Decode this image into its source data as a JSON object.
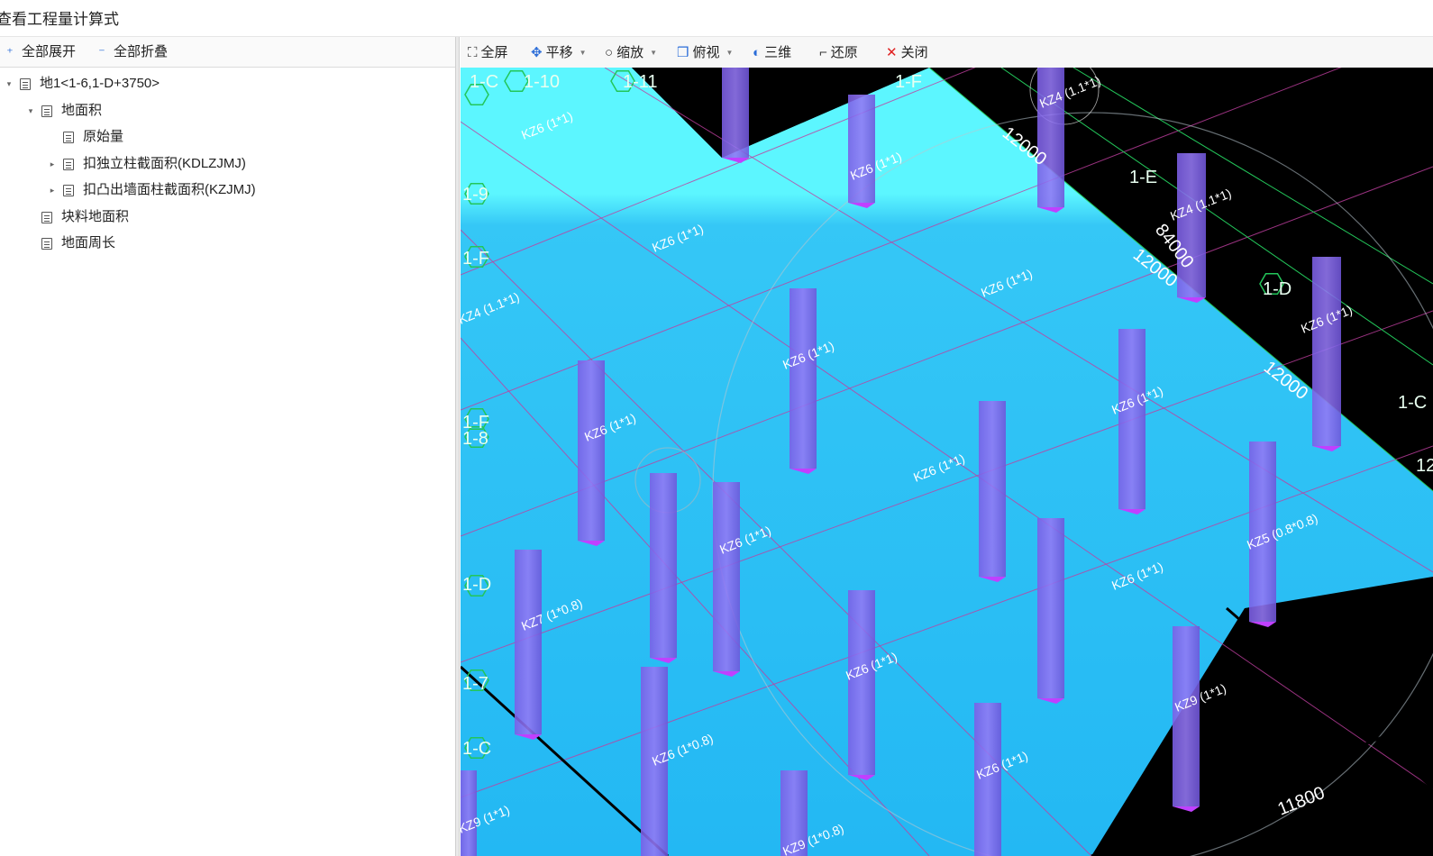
{
  "window": {
    "title": "查看工程量计算式"
  },
  "left_toolbar": {
    "expand_all": "全部展开",
    "collapse_all": "全部折叠"
  },
  "tree": [
    {
      "label": "地1<1-6,1-D+3750>",
      "arrow": "▾"
    },
    {
      "label": "地面积",
      "arrow": "▾"
    },
    {
      "label": "原始量",
      "arrow": ""
    },
    {
      "label": "扣独立柱截面积(KDLZJMJ)",
      "arrow": "▸"
    },
    {
      "label": "扣凸出墙面柱截面积(KZJMJ)",
      "arrow": "▸"
    },
    {
      "label": "块料地面积",
      "arrow": ""
    },
    {
      "label": "地面周长",
      "arrow": ""
    }
  ],
  "view_toolbar": {
    "fullscreen": "全屏",
    "pan": "平移",
    "zoom": "缩放",
    "topview": "俯视",
    "threed": "三维",
    "restore": "还原",
    "close": "关闭"
  },
  "view_icons": {
    "fullscreen": "fullscreen-icon",
    "pan": "pan-icon",
    "zoom": "zoom-icon",
    "topview": "cube-icon",
    "threed": "sphere-icon",
    "restore": "restore-icon",
    "close": "close-icon"
  },
  "colors": {
    "floor_light": "#5cf6ff",
    "floor_main": "#23b8f3",
    "column": "#8a6cf0",
    "grid_line": "#c03fa0",
    "axis_green": "#23c65a",
    "close_red": "#e02020",
    "background": "#000000"
  },
  "scene": {
    "axis_labels": [
      "1-C",
      "1-10",
      "1-11",
      "1-F",
      "1-9",
      "1-F",
      "1-E",
      "1-D",
      "1-F",
      "1-8",
      "1-D",
      "1-7",
      "1-C",
      "1-C",
      "12"
    ],
    "dimensions": [
      "12000",
      "12000",
      "84000",
      "12000",
      "11800"
    ],
    "columns": [
      "KZ6 (1*1)",
      "KZ4 (1.1*1)",
      "KZ6 (1*1)",
      "KZ4 (1.1*1)",
      "KZ6 (1*1)",
      "KZ6 (1*1)",
      "KZ6 (1*1)",
      "KZ4 (1.1*1)",
      "KZ6 (1*1)",
      "KZ6 (1*1)",
      "KZ6 (1*1)",
      "KZ6 (1*1)",
      "KZ6 (1*1)",
      "KZ5 (0.8*0.8)",
      "KZ7 (1*0.8)",
      "KZ6 (1*1)",
      "KZ6 (1*1)",
      "KZ6 (1*0.8)",
      "KZ9 (1*1)",
      "KZ6 (1*1)",
      "KZ9 (1*0.8)",
      "KZ9 (1*1)"
    ]
  }
}
